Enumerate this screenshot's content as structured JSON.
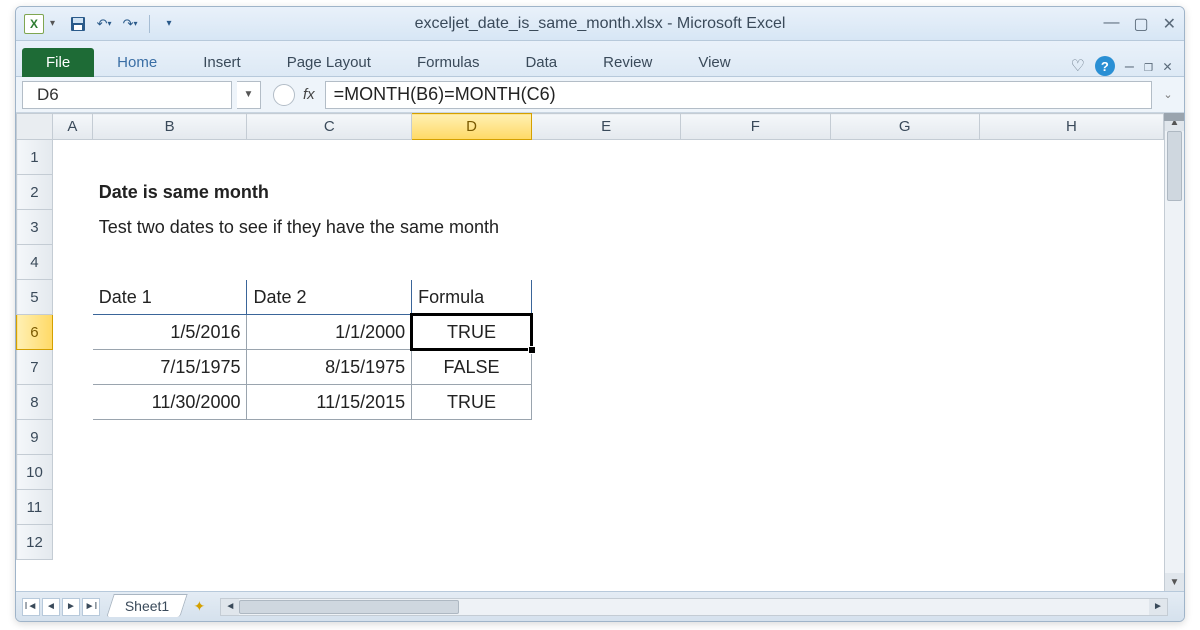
{
  "window": {
    "title": "exceljet_date_is_same_month.xlsx - Microsoft Excel"
  },
  "qat": {
    "excel_letter": "X"
  },
  "ribbon": {
    "file": "File",
    "tabs": [
      "Home",
      "Insert",
      "Page Layout",
      "Formulas",
      "Data",
      "Review",
      "View"
    ]
  },
  "namebox": "D6",
  "fx_label": "fx",
  "formula": "=MONTH(B6)=MONTH(C6)",
  "cols": {
    "A": "A",
    "B": "B",
    "C": "C",
    "D": "D",
    "E": "E",
    "F": "F",
    "G": "G",
    "H": "H"
  },
  "rows": [
    "1",
    "2",
    "3",
    "4",
    "5",
    "6",
    "7",
    "8",
    "9",
    "10",
    "11",
    "12"
  ],
  "content": {
    "heading": "Date is same month",
    "subheading": "Test two dates to see if they have the same month"
  },
  "table": {
    "headers": {
      "date1": "Date 1",
      "date2": "Date 2",
      "formula": "Formula"
    },
    "rows": [
      {
        "date1": "1/5/2016",
        "date2": "1/1/2000",
        "formula": "TRUE"
      },
      {
        "date1": "7/15/1975",
        "date2": "8/15/1975",
        "formula": "FALSE"
      },
      {
        "date1": "11/30/2000",
        "date2": "11/15/2015",
        "formula": "TRUE"
      }
    ]
  },
  "sheet": {
    "name": "Sheet1"
  }
}
